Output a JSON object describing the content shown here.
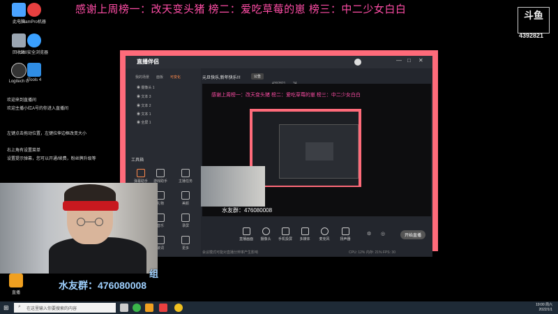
{
  "banner": "感谢上周榜一：改天变头猪 榜二：爱吃草莓的崽 榜三：中二少女白白",
  "logo": {
    "text": "斗鱼",
    "room_no": "4392821"
  },
  "desktop_icons": [
    {
      "label": "此电脑",
      "color": "#4aa3ff"
    },
    {
      "label": "SamPro机器",
      "color": "#e84040"
    },
    {
      "label": "回收站",
      "color": "#9aa5b1"
    },
    {
      "label": "360安全浏览器",
      "color": "#3aa0ff"
    },
    {
      "label": "Logitech G",
      "color": "#333333"
    },
    {
      "label": "iTools 4",
      "color": "#2f8de4"
    },
    {
      "label": "直播",
      "color": "#f0a020"
    }
  ],
  "app": {
    "title": "直播伴侣",
    "scene_tabs": [
      "我的场景",
      "面板",
      "可变化"
    ],
    "sources": [
      "摄像头 1",
      "文本 3",
      "文本 2",
      "文本 1",
      "全屏 1"
    ],
    "toolbox_title": "工具箱",
    "tools": [
      "弹幕助手",
      "游戏助手",
      "主播任务",
      "礼物",
      "美颜",
      "音乐",
      "录屏",
      "歌词",
      "更多"
    ],
    "stream_title": "元旦快乐,新年快乐!!!",
    "notice_btn": "公告",
    "room_id": "4392821",
    "fans": "34",
    "controls": [
      "直播画面",
      "摄像头",
      "手机投屏",
      "多媒体",
      "麦克风",
      "扬声器"
    ],
    "start_btn": "开始直播",
    "status": "CPU: 12%  内存: 21%  FPS: 30",
    "tip": "会议模式可能对直播分辨率产生影响"
  },
  "overlay": {
    "group_text": "水友群：476080008",
    "group_text_small": "水友群：476080008",
    "lower_partial": "组"
  },
  "chat": [
    "欢迎来到直播间",
    "欢迎主播小红A号的你进入直播间",
    "左键点击拖动位置，左键拉伸边框改变大小",
    "右上角有设置菜单",
    "设置提示弹幕，您可以开通/续费，粉丝牌升级等"
  ],
  "taskbar": {
    "search_placeholder": "在这里输入你要搜索的内容",
    "time": "19:00 周六",
    "date": "2022/1/1"
  }
}
